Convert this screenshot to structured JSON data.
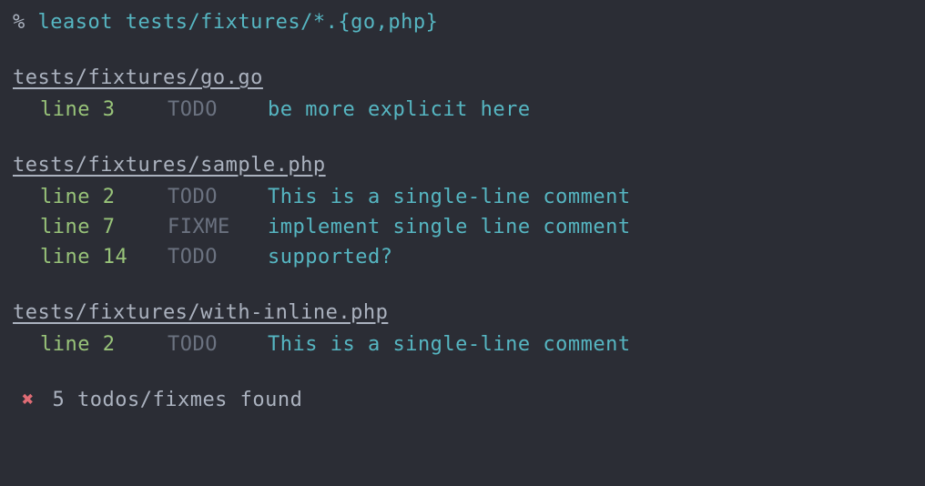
{
  "prompt": {
    "symbol": "%",
    "command": "leasot tests/fixtures/*.{go,php}"
  },
  "files": [
    {
      "path": "tests/fixtures/go.go",
      "results": [
        {
          "line": "line 3",
          "tag": "TODO",
          "message": "be more explicit here"
        }
      ]
    },
    {
      "path": "tests/fixtures/sample.php",
      "results": [
        {
          "line": "line 2",
          "tag": "TODO",
          "message": "This is a single-line comment"
        },
        {
          "line": "line 7",
          "tag": "FIXME",
          "message": "implement single line comment"
        },
        {
          "line": "line 14",
          "tag": "TODO",
          "message": "supported?"
        }
      ]
    },
    {
      "path": "tests/fixtures/with-inline.php",
      "results": [
        {
          "line": "line 2",
          "tag": "TODO",
          "message": "This is a single-line comment"
        }
      ]
    }
  ],
  "summary": {
    "mark": "✖",
    "text": "5 todos/fixmes found"
  }
}
